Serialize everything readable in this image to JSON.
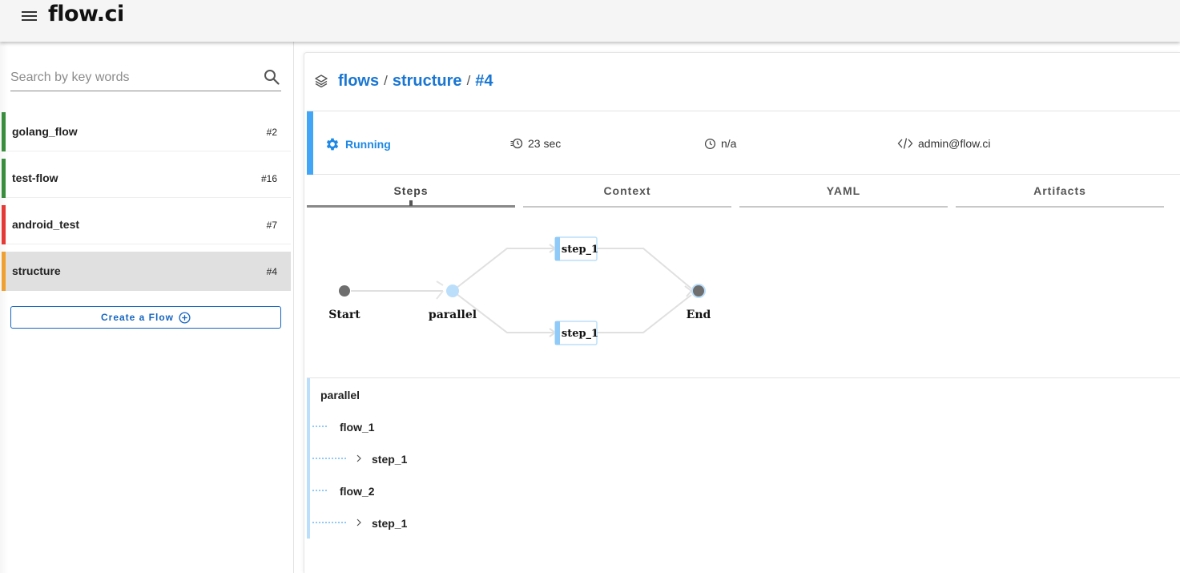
{
  "app": {
    "logo": "flow.ci"
  },
  "sidebar": {
    "search_placeholder": "Search by key words",
    "flows": [
      {
        "name": "golang_flow",
        "number": "#2",
        "status_color": "#388e3c"
      },
      {
        "name": "test-flow",
        "number": "#16",
        "status_color": "#388e3c"
      },
      {
        "name": "android_test",
        "number": "#7",
        "status_color": "#e53935"
      },
      {
        "name": "structure",
        "number": "#4",
        "status_color": "#f0a030",
        "selected": true
      }
    ],
    "create_label": "Create a Flow"
  },
  "breadcrumb": {
    "root": "flows",
    "flow": "structure",
    "job": "#4",
    "separator": "/"
  },
  "job": {
    "status": "Running",
    "duration": "23 sec",
    "finished": "n/a",
    "trigger_user": "admin@flow.ci",
    "status_color": "#1e88e5"
  },
  "tabs": [
    {
      "label": "Steps",
      "active": true
    },
    {
      "label": "Context"
    },
    {
      "label": "YAML"
    },
    {
      "label": "Artifacts"
    }
  ],
  "graph": {
    "nodes": [
      {
        "label": "Start"
      },
      {
        "label": "parallel"
      },
      {
        "label": "step_1"
      },
      {
        "label": "step_1"
      },
      {
        "label": "End"
      }
    ]
  },
  "tree": [
    {
      "label": "parallel",
      "level": 0
    },
    {
      "label": "flow_1",
      "level": 1
    },
    {
      "label": "step_1",
      "level": 2
    },
    {
      "label": "flow_2",
      "level": 1
    },
    {
      "label": "step_1",
      "level": 2
    }
  ]
}
